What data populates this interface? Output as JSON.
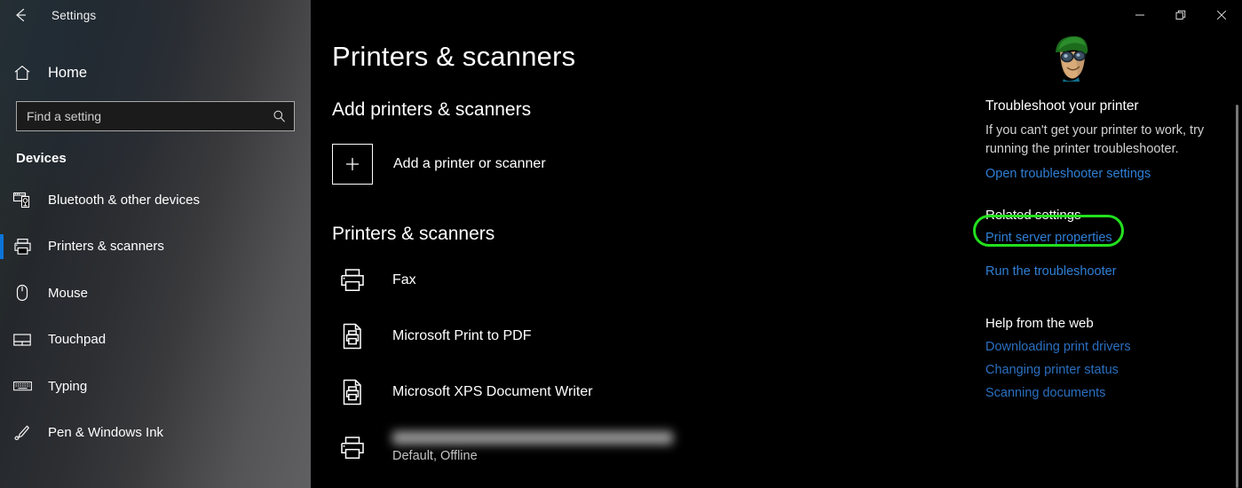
{
  "window": {
    "title": "Settings",
    "back_icon": "back-arrow-icon",
    "controls": [
      {
        "name": "minimize",
        "label": "Minimize"
      },
      {
        "name": "restore",
        "label": "Restore"
      },
      {
        "name": "close",
        "label": "Close"
      }
    ]
  },
  "sidebar": {
    "home_label": "Home",
    "home_icon": "home-icon",
    "search": {
      "placeholder": "Find a setting",
      "value": "",
      "icon": "search-icon"
    },
    "section_label": "Devices",
    "items": [
      {
        "label": "Bluetooth & other devices",
        "icon": "bluetooth-devices-icon",
        "selected": false
      },
      {
        "label": "Printers & scanners",
        "icon": "printer-icon",
        "selected": true
      },
      {
        "label": "Mouse",
        "icon": "mouse-icon",
        "selected": false
      },
      {
        "label": "Touchpad",
        "icon": "touchpad-icon",
        "selected": false
      },
      {
        "label": "Typing",
        "icon": "keyboard-icon",
        "selected": false
      },
      {
        "label": "Pen & Windows Ink",
        "icon": "pen-icon",
        "selected": false
      }
    ]
  },
  "main": {
    "page_title": "Printers & scanners",
    "add_section_heading": "Add printers & scanners",
    "add_button_label": "Add a printer or scanner",
    "add_button_icon": "plus-icon",
    "list_heading": "Printers & scanners",
    "printers": [
      {
        "name": "Fax",
        "status": "",
        "icon": "printer-icon",
        "redacted": false
      },
      {
        "name": "Microsoft Print to PDF",
        "status": "",
        "icon": "document-printer-icon",
        "redacted": false
      },
      {
        "name": "Microsoft XPS Document Writer",
        "status": "",
        "icon": "document-printer-icon",
        "redacted": false
      },
      {
        "name": "",
        "status": "Default, Offline",
        "icon": "printer-icon",
        "redacted": true
      }
    ]
  },
  "right_panel": {
    "illustration_icon": "character-avatar-icon",
    "troubleshoot_title": "Troubleshoot your printer",
    "troubleshoot_body": "If you can't get your printer to work, try running the printer troubleshooter.",
    "troubleshoot_link": "Open troubleshooter settings",
    "related_heading": "Related settings",
    "related_links": [
      "Print server properties",
      "Run the troubleshooter"
    ],
    "web_heading": "Help from the web",
    "web_links": [
      "Downloading print drivers",
      "Changing printer status",
      "Scanning documents"
    ]
  },
  "annotation": {
    "target": "Print server properties",
    "color": "#22e01e",
    "shape": "ellipse"
  },
  "colors": {
    "accent_blue": "#0a74d8",
    "link_blue": "#2f7fd6",
    "link_blue_dim": "#2a6fc0",
    "highlight_green": "#22e01e",
    "background": "#000000",
    "sidebar_gradient_start": "#28302e",
    "sidebar_gradient_end": "#606062"
  }
}
